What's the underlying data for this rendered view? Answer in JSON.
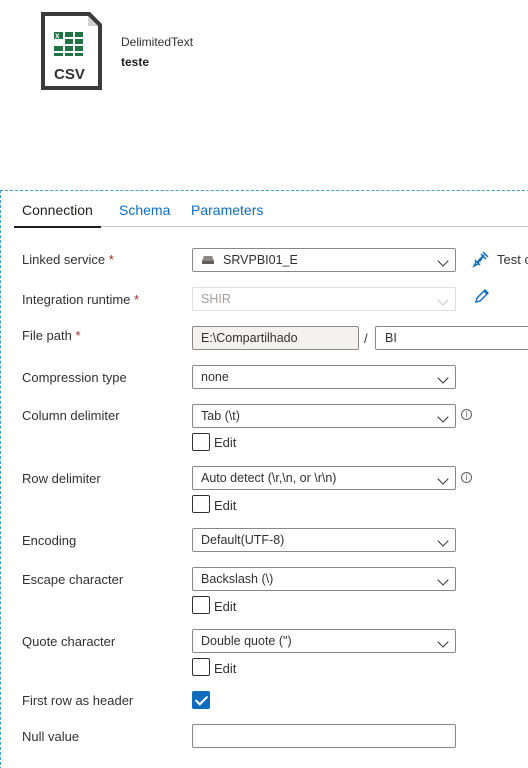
{
  "dataset": {
    "type": "DelimitedText",
    "name": "teste",
    "icon_text": "CSV"
  },
  "tabs": [
    {
      "label": "Connection",
      "active": true
    },
    {
      "label": "Schema",
      "active": false
    },
    {
      "label": "Parameters",
      "active": false
    }
  ],
  "fields": {
    "linked_service": {
      "label": "Linked service",
      "value": "SRVPBI01_E",
      "test_label": "Test c"
    },
    "integration_runtime": {
      "label": "Integration runtime",
      "value": "SHIR"
    },
    "file_path": {
      "label": "File path",
      "path1": "E:\\Compartilhado",
      "separator": "/",
      "path2": "BI"
    },
    "compression_type": {
      "label": "Compression type",
      "value": "none"
    },
    "column_delimiter": {
      "label": "Column delimiter",
      "value": "Tab (\\t)",
      "edit_label": "Edit"
    },
    "row_delimiter": {
      "label": "Row delimiter",
      "value": "Auto detect (\\r,\\n, or \\r\\n)",
      "edit_label": "Edit"
    },
    "encoding": {
      "label": "Encoding",
      "value": "Default(UTF-8)"
    },
    "escape_character": {
      "label": "Escape character",
      "value": "Backslash (\\)",
      "edit_label": "Edit"
    },
    "quote_character": {
      "label": "Quote character",
      "value": "Double quote (\")",
      "edit_label": "Edit"
    },
    "first_row_header": {
      "label": "First row as header",
      "checked": true
    },
    "null_value": {
      "label": "Null value",
      "value": ""
    }
  },
  "required_mark": "*",
  "info_glyph": "i",
  "colors": {
    "accent": "#0f6cbd",
    "required": "#a4262c",
    "excel_green": "#217346",
    "panel_border": "#3aa0c8"
  }
}
